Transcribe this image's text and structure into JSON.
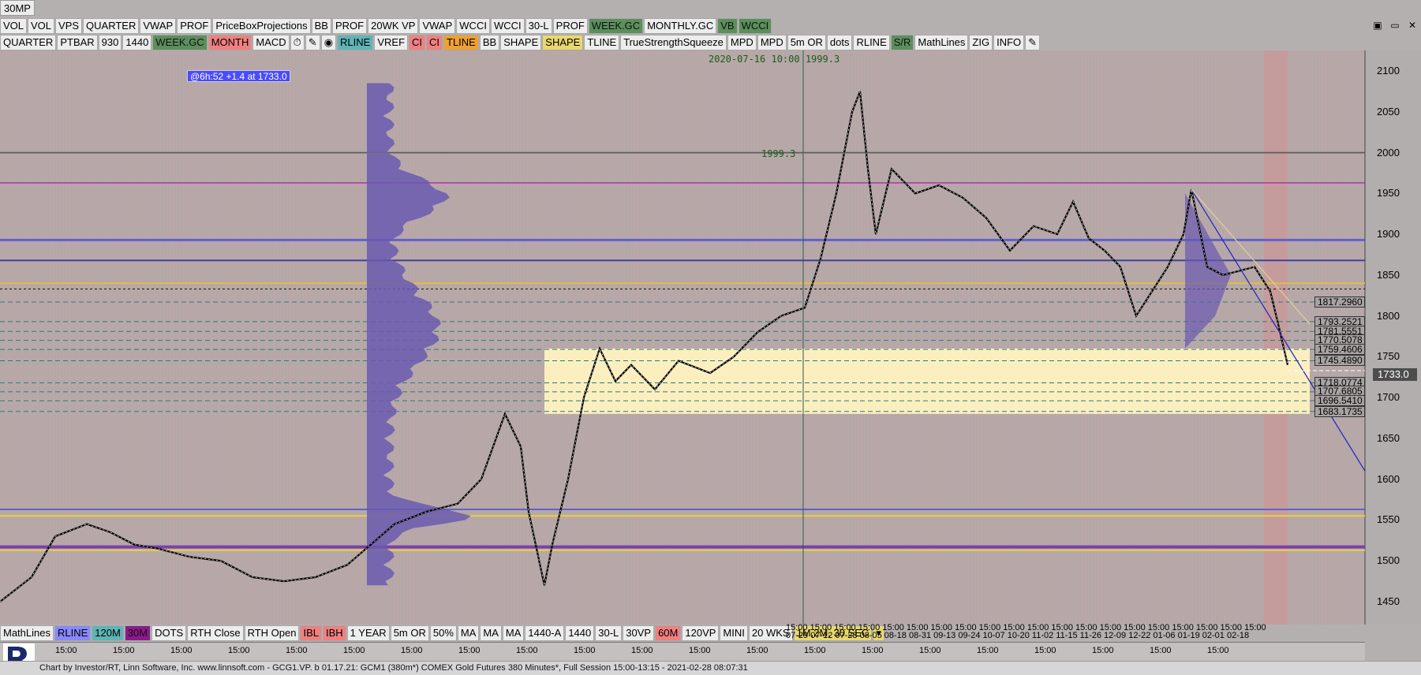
{
  "window": {
    "title": "30MP"
  },
  "toolbar_top": [
    {
      "label": "VOL",
      "bg": "#ededed"
    },
    {
      "label": "VOL",
      "bg": "#ededed"
    },
    {
      "label": "VPS",
      "bg": "#ededed"
    },
    {
      "label": "QUARTER",
      "bg": "#ededed"
    },
    {
      "label": "VWAP",
      "bg": "#ededed"
    },
    {
      "label": "PROF",
      "bg": "#ededed"
    },
    {
      "label": "PriceBoxProjections",
      "bg": "#ededed"
    },
    {
      "label": "BB",
      "bg": "#ededed"
    },
    {
      "label": "PROF",
      "bg": "#ededed"
    },
    {
      "label": "20WK VP",
      "bg": "#ededed"
    },
    {
      "label": "VWAP",
      "bg": "#ededed"
    },
    {
      "label": "WCCI",
      "bg": "#ededed"
    },
    {
      "label": "WCCI",
      "bg": "#ededed"
    },
    {
      "label": "30-L",
      "bg": "#ededed"
    },
    {
      "label": "PROF",
      "bg": "#ededed"
    },
    {
      "label": "WEEK.GC",
      "bg": "#5b8f5b"
    },
    {
      "label": "MONTHLY.GC",
      "bg": "#ededed"
    },
    {
      "label": "VB",
      "bg": "#5b8f5b"
    },
    {
      "label": "WCCI",
      "bg": "#5b8f5b"
    }
  ],
  "toolbar_second": [
    {
      "label": "QUARTER",
      "bg": "#ededed"
    },
    {
      "label": "PTBAR",
      "bg": "#ededed"
    },
    {
      "label": "930",
      "bg": "#ededed"
    },
    {
      "label": "1440",
      "bg": "#ededed"
    },
    {
      "label": "WEEK.GC",
      "bg": "#5b8f5b"
    },
    {
      "label": "MONTH",
      "bg": "#f08080"
    },
    {
      "label": "MACD",
      "bg": "#ededed"
    },
    {
      "label": "⏱",
      "bg": "#ededed"
    },
    {
      "label": "✎",
      "bg": "#ededed"
    },
    {
      "label": "◉",
      "bg": "#ededed"
    },
    {
      "label": "RLINE",
      "bg": "#5fb5b5"
    },
    {
      "label": "VREF",
      "bg": "#ededed"
    },
    {
      "label": "CI",
      "bg": "#f08080"
    },
    {
      "label": "CI",
      "bg": "#f08080"
    },
    {
      "label": "TLINE",
      "bg": "#f0a030"
    },
    {
      "label": "BB",
      "bg": "#ededed"
    },
    {
      "label": "SHAPE",
      "bg": "#ededed"
    },
    {
      "label": "SHAPE",
      "bg": "#e8d870"
    },
    {
      "label": "TLINE",
      "bg": "#ededed"
    },
    {
      "label": "TrueStrengthSqueeze",
      "bg": "#ededed"
    },
    {
      "label": "MPD",
      "bg": "#ededed"
    },
    {
      "label": "MPD",
      "bg": "#ededed"
    },
    {
      "label": "5m OR",
      "bg": "#ededed"
    },
    {
      "label": "dots",
      "bg": "#ededed"
    },
    {
      "label": "RLINE",
      "bg": "#ededed"
    },
    {
      "label": "S/R",
      "bg": "#5b8f5b"
    },
    {
      "label": "MathLines",
      "bg": "#ededed"
    },
    {
      "label": "ZIG",
      "bg": "#ededed"
    },
    {
      "label": "INFO",
      "bg": "#ededed"
    },
    {
      "label": "✎",
      "bg": "#ededed"
    }
  ],
  "toolbar_bottom": [
    {
      "label": "MathLines",
      "bg": "#ededed"
    },
    {
      "label": "RLINE",
      "bg": "#8888ff"
    },
    {
      "label": "120M",
      "bg": "#5fb5b5"
    },
    {
      "label": "30M",
      "bg": "#8b1a8b"
    },
    {
      "label": "DOTS",
      "bg": "#ededed"
    },
    {
      "label": "RTH Close",
      "bg": "#ededed"
    },
    {
      "label": "RTH Open",
      "bg": "#ededed"
    },
    {
      "label": "IBL",
      "bg": "#f08080"
    },
    {
      "label": "IBH",
      "bg": "#f08080"
    },
    {
      "label": "1 YEAR",
      "bg": "#ededed"
    },
    {
      "label": "5m OR",
      "bg": "#ededed"
    },
    {
      "label": "50%",
      "bg": "#ededed"
    },
    {
      "label": "MA",
      "bg": "#ededed"
    },
    {
      "label": "MA",
      "bg": "#ededed"
    },
    {
      "label": "MA",
      "bg": "#ededed"
    },
    {
      "label": "1440-A",
      "bg": "#ededed"
    },
    {
      "label": "1440",
      "bg": "#ededed"
    },
    {
      "label": "30-L",
      "bg": "#ededed"
    },
    {
      "label": "30VP",
      "bg": "#ededed"
    },
    {
      "label": "60M",
      "bg": "#f08080"
    },
    {
      "label": "120VP",
      "bg": "#ededed"
    },
    {
      "label": "MINI",
      "bg": "#ededed"
    },
    {
      "label": "20 WKS",
      "bg": "#ededed"
    },
    {
      "label": "1M,2M, 30 SEC",
      "bg": "#e8d870"
    },
    {
      "label": "▾",
      "bg": "#e8d870"
    }
  ],
  "window_controls": [
    "▣",
    "▭",
    "✕"
  ],
  "cursor_annotation": "@6h:52  +1.4 at 1733.0",
  "cursor_time": "2020-07-16 10:00  1999.3",
  "price_note": "1999.3",
  "last_price": "1733.0",
  "price_axis": [
    "2100",
    "2050",
    "2000",
    "1950",
    "1900",
    "1850",
    "1800",
    "1750",
    "1700",
    "1650",
    "1600",
    "1550",
    "1500",
    "1450"
  ],
  "level_labels": [
    "1817.2960",
    "1793.2521",
    "1781.5551",
    "1770.5078",
    "1759.4606",
    "1745.4890",
    "1718.0774",
    "1707.6805",
    "1696.5410",
    "1683.1735"
  ],
  "date_strip": "15:00 15:00 15:00 15:00 15:00 15:00 15:00 15:00 15:00 15:00 15:00 15:00 15:00 15:00 15:00 15:00 15:00 15:00 15:00 15:00",
  "date_strip_2": "07-29 07-12 07-23 08-05 08-18 08-31 09-13 09-24 10-07 10-20 11-02 11-15 11-26 12-09 12-22 01-06 01-19 02-01 02-18",
  "time_ticks": [
    "15:00",
    "15:00",
    "15:00",
    "15:00",
    "15:00",
    "15:00",
    "15:00",
    "15:00",
    "15:00",
    "15:00",
    "15:00",
    "15:00",
    "15:00",
    "15:00",
    "15:00",
    "15:00",
    "15:00",
    "15:00",
    "15:00",
    "15:00",
    "15:00"
  ],
  "status": "Chart by Investor/RT, Linn Software, Inc. www.linnsoft.com - GCG1.VP. b  01.17.21: GCM1 (380m*) COMEX Gold Futures 380 Minutes*, Full Session 15:00-13:15 - 2021-02-28 08:07:31",
  "colors": {
    "chart_bg": "#b5a9a9",
    "value_box": "#fbefc0",
    "profile": "#6a5ab0",
    "poc": "#7a4fc0",
    "yellow_line": "#e8d040"
  }
}
